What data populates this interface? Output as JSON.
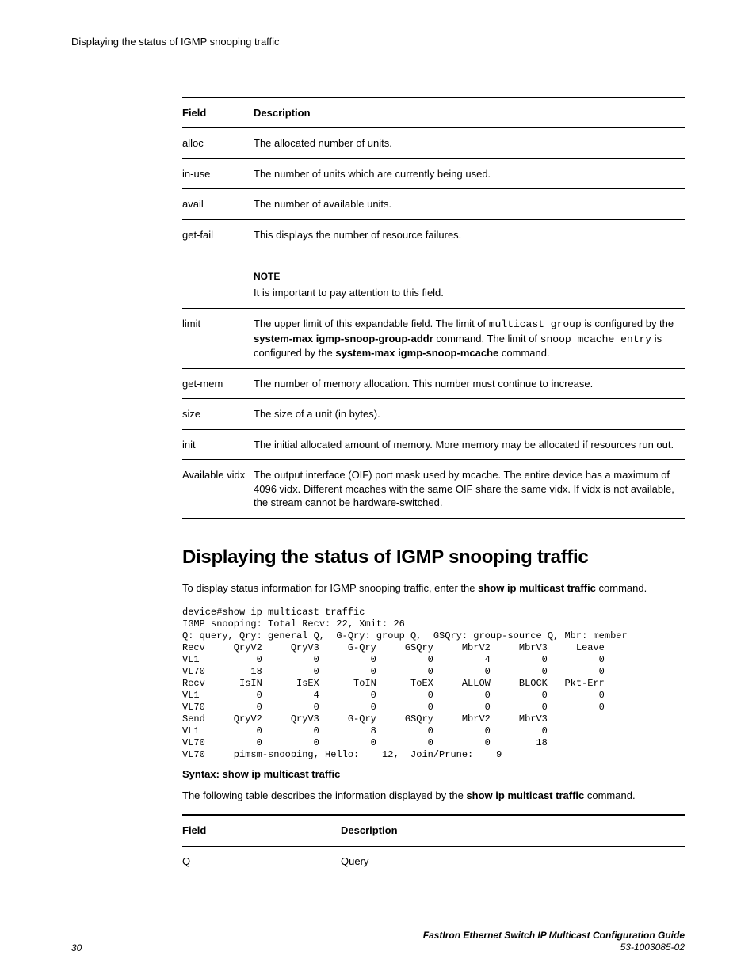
{
  "running_head": "Displaying the status of IGMP snooping traffic",
  "table1": {
    "head_field": "Field",
    "head_desc": "Description",
    "rows": {
      "alloc": {
        "f": "alloc",
        "d": "The allocated number of units."
      },
      "inuse": {
        "f": "in-use",
        "d": "The number of units which are currently being used."
      },
      "avail": {
        "f": "avail",
        "d": "The number of available units."
      },
      "getfail": {
        "f": "get-fail",
        "d": "This displays the number of resource failures."
      },
      "note_label": "NOTE",
      "note_text": "It is important to pay attention to this field.",
      "limit": {
        "f": "limit",
        "d_pre": "The upper limit of this expandable field. The limit of ",
        "d_code1": "multicast group",
        "d_mid1": " is configured by the ",
        "d_bold1": "system-max igmp-snoop-group-addr",
        "d_mid2": " command. The limit of ",
        "d_code2": "snoop mcache entry",
        "d_mid3": " is configured by the ",
        "d_bold2": "system-max igmp-snoop-mcache",
        "d_post": " command."
      },
      "getmem": {
        "f": "get-mem",
        "d": "The number of memory allocation. This number must continue to increase."
      },
      "size": {
        "f": "size",
        "d": "The size of a unit (in bytes)."
      },
      "init": {
        "f": "init",
        "d": "The initial allocated amount of memory. More memory may be allocated if resources run out."
      },
      "availvidx": {
        "f": "Available vidx",
        "d": "The output interface (OIF) port mask used by mcache. The entire device has a maximum of 4096 vidx. Different mcaches with the same OIF share the same vidx. If vidx is not available, the stream cannot be hardware-switched."
      }
    }
  },
  "section_title": "Displaying the status of IGMP snooping traffic",
  "intro_pre": "To display status information for IGMP snooping traffic, enter the ",
  "intro_bold": "show ip multicast traffic",
  "intro_post": " command.",
  "cli": "device#show ip multicast traffic\nIGMP snooping: Total Recv: 22, Xmit: 26\nQ: query, Qry: general Q,  G-Qry: group Q,  GSQry: group-source Q, Mbr: member\nRecv     QryV2     QryV3     G-Qry     GSQry     MbrV2     MbrV3     Leave\nVL1          0         0         0         0         4         0         0\nVL70        18         0         0         0         0         0         0\nRecv      IsIN      IsEX      ToIN      ToEX     ALLOW     BLOCK   Pkt-Err\nVL1          0         4         0         0         0         0         0\nVL70         0         0         0         0         0         0         0\nSend     QryV2     QryV3     G-Qry     GSQry     MbrV2     MbrV3\nVL1          0         0         8         0         0         0\nVL70         0         0         0         0         0        18\nVL70     pimsm-snooping, Hello:    12,  Join/Prune:    9",
  "syntax": "Syntax: show ip multicast traffic",
  "following_pre": "The following table describes the information displayed by the ",
  "following_bold": "show ip multicast traffic",
  "following_post": " command.",
  "table2": {
    "head_field": "Field",
    "head_desc": "Description",
    "row1_f": "Q",
    "row1_d": "Query"
  },
  "footer": {
    "page": "30",
    "title": "FastIron Ethernet Switch IP Multicast Configuration Guide",
    "docnum": "53-1003085-02"
  }
}
